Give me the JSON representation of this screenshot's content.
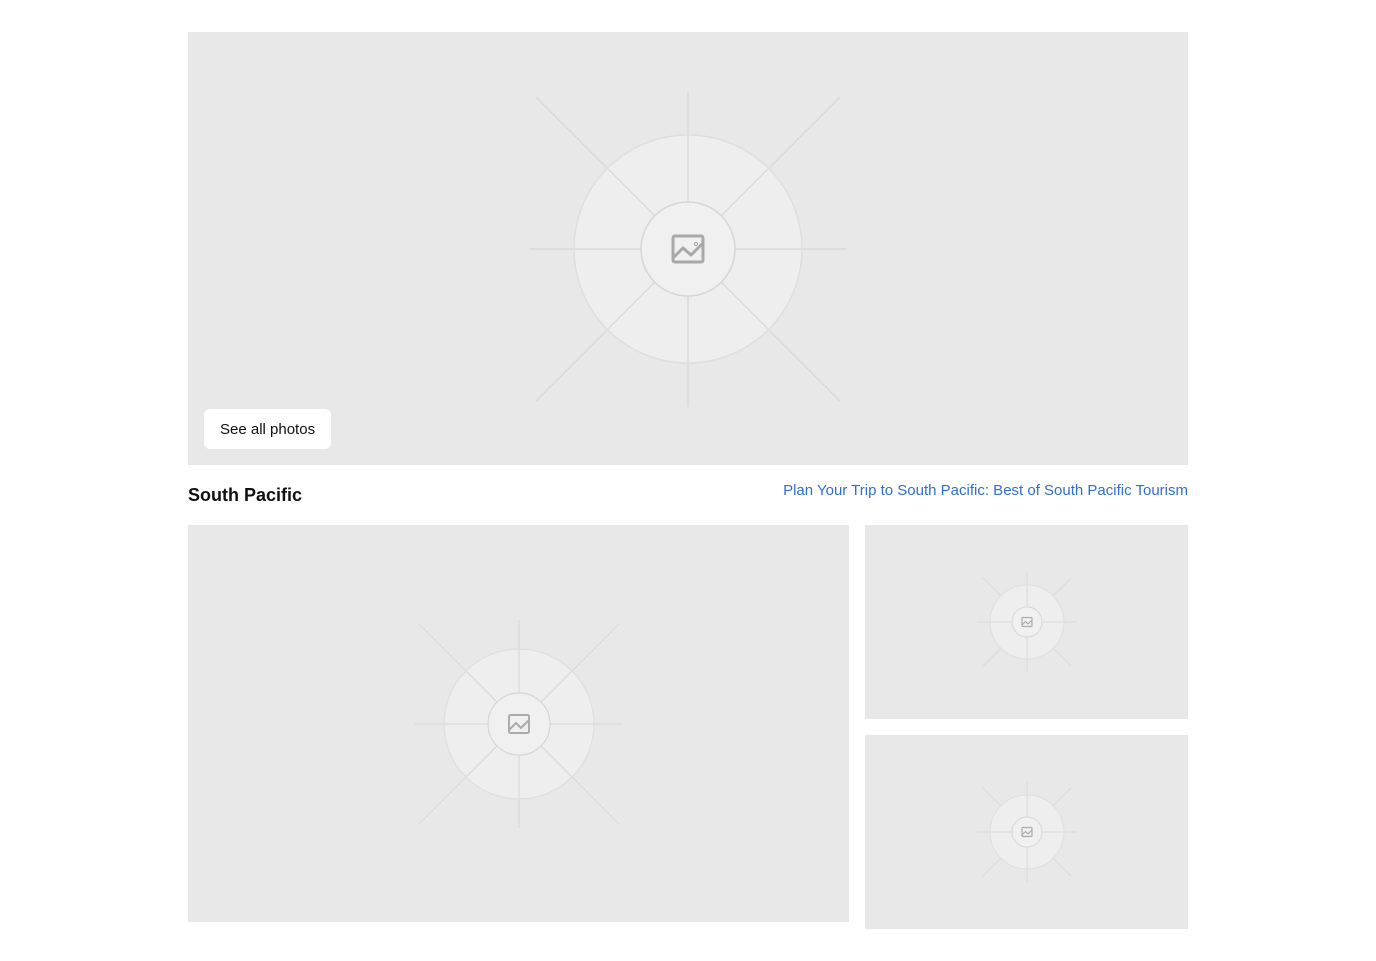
{
  "hero": {
    "image_icon": "image-placeholder-icon",
    "see_all_label": "See all photos"
  },
  "section": {
    "title": "South Pacific",
    "link_text": "Plan Your Trip to South Pacific: Best of South Pacific Tourism"
  },
  "gallery": {
    "main_icon": "image-placeholder-icon",
    "side_icons": [
      "image-placeholder-icon",
      "image-placeholder-icon"
    ]
  },
  "colors": {
    "placeholder_bg": "#e8e8e8",
    "link": "#2f6fd1",
    "text": "#111111",
    "button_bg": "#ffffff"
  }
}
